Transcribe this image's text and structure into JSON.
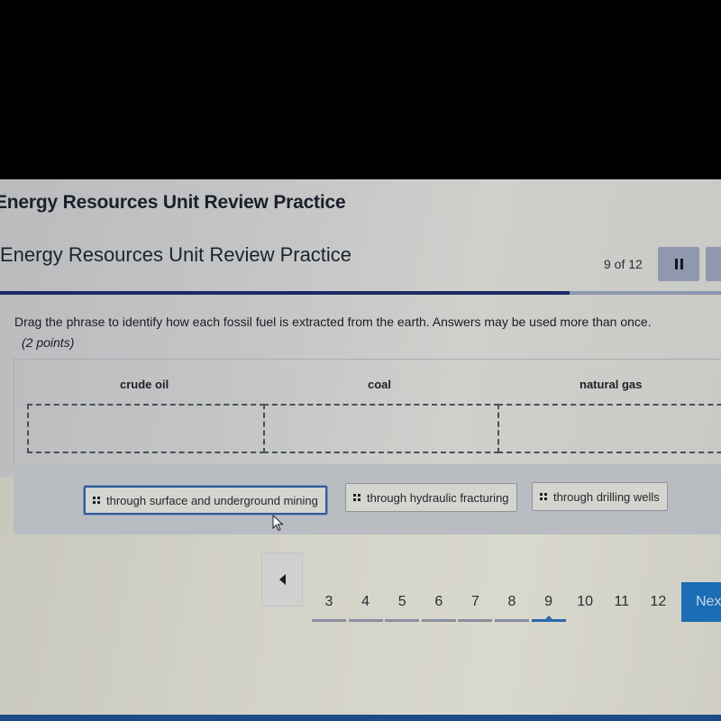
{
  "app": {
    "title": "Energy Resources Unit Review Practice"
  },
  "assessment": {
    "title": "Energy Resources Unit Review Practice",
    "counter": "9 of 12",
    "progress_fraction": 0.79,
    "pause_icon": "pause-icon",
    "menu_icon": "menu-icon"
  },
  "question": {
    "prompt": "Drag the phrase to identify how each fossil fuel is extracted from the earth. Answers may be used more than once.",
    "points": "(2 points)",
    "categories": [
      {
        "label": "crude oil"
      },
      {
        "label": "coal"
      },
      {
        "label": "natural gas"
      }
    ],
    "answers": [
      {
        "label": "through surface and underground mining",
        "selected": true
      },
      {
        "label": "through hydraulic fracturing",
        "selected": false
      },
      {
        "label": "through drilling wells",
        "selected": false
      }
    ]
  },
  "pager": {
    "prev_icon": "triangle-left-icon",
    "pages": [
      "3",
      "4",
      "5",
      "6",
      "7",
      "8",
      "9",
      "10",
      "11",
      "12"
    ],
    "current": "9",
    "visited": [
      "3",
      "4",
      "5",
      "6",
      "7",
      "8",
      "9"
    ],
    "next_label": "Next"
  }
}
